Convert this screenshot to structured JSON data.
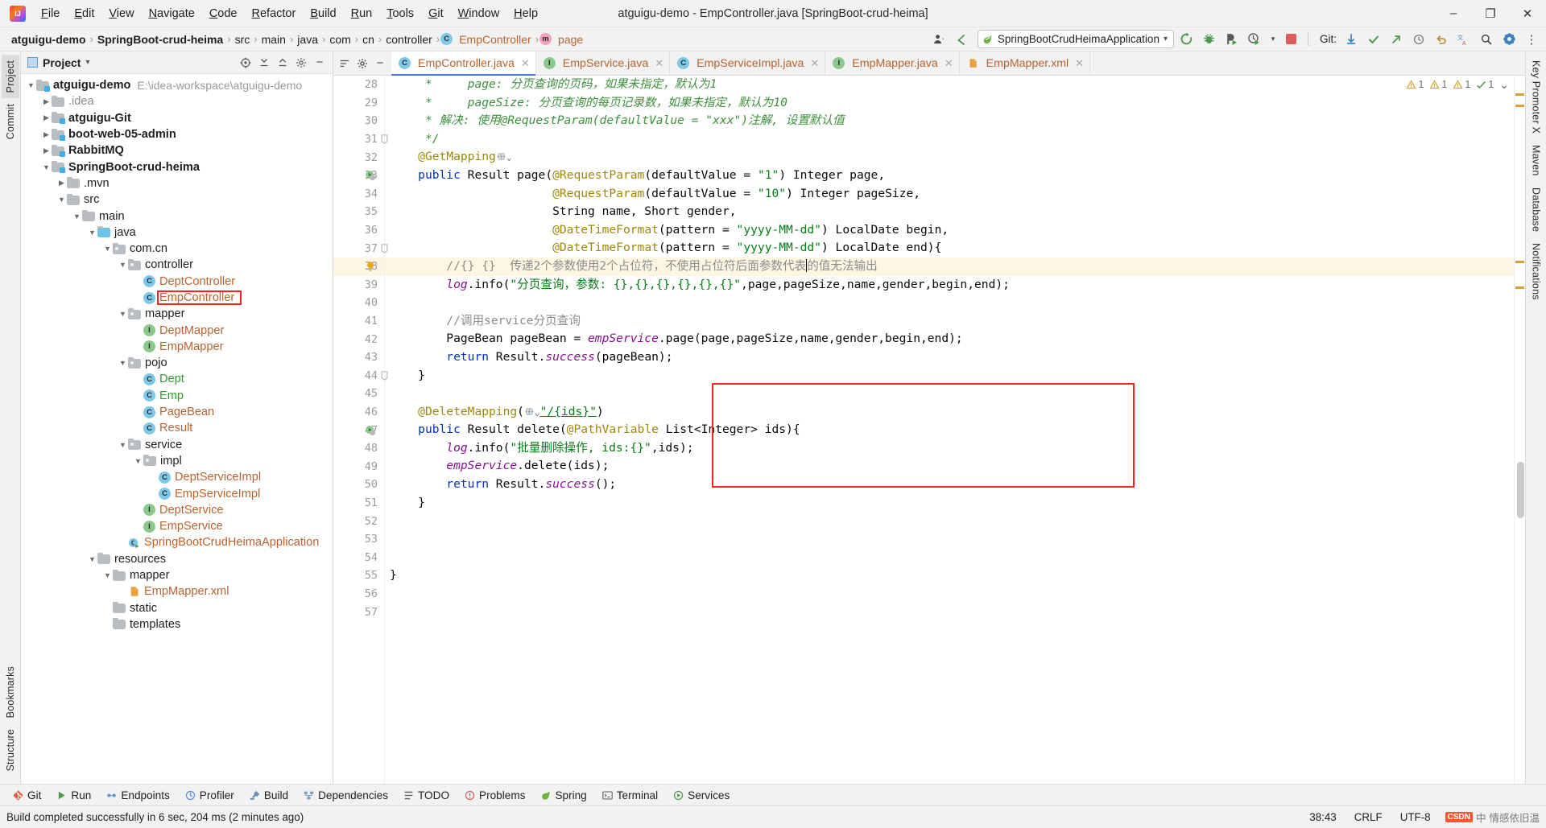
{
  "window": {
    "title": "atguigu-demo - EmpController.java [SpringBoot-crud-heima]",
    "minimize": "–",
    "maximize": "❐",
    "close": "✕"
  },
  "menubar": [
    {
      "label": "File"
    },
    {
      "label": "Edit"
    },
    {
      "label": "View"
    },
    {
      "label": "Navigate"
    },
    {
      "label": "Code"
    },
    {
      "label": "Refactor"
    },
    {
      "label": "Build"
    },
    {
      "label": "Run"
    },
    {
      "label": "Tools"
    },
    {
      "label": "Git"
    },
    {
      "label": "Window"
    },
    {
      "label": "Help"
    }
  ],
  "breadcrumb": [
    {
      "label": "atguigu-demo",
      "bold": true,
      "icon": ""
    },
    {
      "label": "SpringBoot-crud-heima",
      "bold": true,
      "icon": ""
    },
    {
      "label": "src",
      "bold": false,
      "icon": ""
    },
    {
      "label": "main",
      "bold": false,
      "icon": ""
    },
    {
      "label": "java",
      "bold": false,
      "icon": ""
    },
    {
      "label": "com",
      "bold": false,
      "icon": ""
    },
    {
      "label": "cn",
      "bold": false,
      "icon": ""
    },
    {
      "label": "controller",
      "bold": false,
      "icon": ""
    },
    {
      "label": "EmpController",
      "bold": false,
      "icon": "class",
      "orange": true
    },
    {
      "label": "page",
      "bold": false,
      "icon": "method",
      "orange": true
    }
  ],
  "toolbar": {
    "run_config": "SpringBootCrudHeimaApplication",
    "run_config_dropdown": "▾",
    "git_label": "Git:",
    "icons": {
      "user": "user-icon",
      "back_arrow": "back-arrow-icon",
      "rerun": "rerun-icon",
      "debug": "debug-icon",
      "run_with_coverage": "run-with-coverage-icon",
      "profiler": "profiler-icon",
      "stop": "stop-icon",
      "git_update": "git-update-icon",
      "git_commit": "git-commit-icon",
      "git_push": "git-push-icon",
      "git_history": "git-history-icon",
      "undo": "undo-icon",
      "translate": "translate-icon",
      "search": "search-icon",
      "settings_gear": "gear-icon",
      "more": "more-icon"
    }
  },
  "project_panel": {
    "title": "Project",
    "caret": "▾",
    "header_buttons": [
      "target-icon",
      "collapse-icon",
      "expand-icon",
      "gear-icon",
      "hide-icon"
    ],
    "tree": [
      {
        "depth": 0,
        "arrow": "v",
        "kind": "module",
        "label": "atguigu-demo",
        "bold": true,
        "path": "E:\\idea-workspace\\atguigu-demo"
      },
      {
        "depth": 1,
        "arrow": ">",
        "kind": "folder",
        "label": ".idea",
        "grey": true
      },
      {
        "depth": 1,
        "arrow": ">",
        "kind": "module",
        "label": "atguigu-Git",
        "bold": true
      },
      {
        "depth": 1,
        "arrow": ">",
        "kind": "module",
        "label": "boot-web-05-admin",
        "bold": true
      },
      {
        "depth": 1,
        "arrow": ">",
        "kind": "module",
        "label": "RabbitMQ",
        "bold": true
      },
      {
        "depth": 1,
        "arrow": "v",
        "kind": "module",
        "label": "SpringBoot-crud-heima",
        "bold": true
      },
      {
        "depth": 2,
        "arrow": ">",
        "kind": "folder",
        "label": ".mvn"
      },
      {
        "depth": 2,
        "arrow": "v",
        "kind": "folder",
        "label": "src"
      },
      {
        "depth": 3,
        "arrow": "v",
        "kind": "folder",
        "label": "main"
      },
      {
        "depth": 4,
        "arrow": "v",
        "kind": "source",
        "label": "java"
      },
      {
        "depth": 5,
        "arrow": "v",
        "kind": "package",
        "label": "com.cn"
      },
      {
        "depth": 6,
        "arrow": "v",
        "kind": "package",
        "label": "controller"
      },
      {
        "depth": 7,
        "arrow": "",
        "kind": "class",
        "label": "DeptController",
        "orange": true
      },
      {
        "depth": 7,
        "arrow": "",
        "kind": "class",
        "label": "EmpController",
        "orange": true,
        "highlight": true
      },
      {
        "depth": 6,
        "arrow": "v",
        "kind": "package",
        "label": "mapper"
      },
      {
        "depth": 7,
        "arrow": "",
        "kind": "iface",
        "label": "DeptMapper",
        "orange": true
      },
      {
        "depth": 7,
        "arrow": "",
        "kind": "iface",
        "label": "EmpMapper",
        "orange": true
      },
      {
        "depth": 6,
        "arrow": "v",
        "kind": "package",
        "label": "pojo"
      },
      {
        "depth": 7,
        "arrow": "",
        "kind": "class",
        "label": "Dept",
        "green": true
      },
      {
        "depth": 7,
        "arrow": "",
        "kind": "class",
        "label": "Emp",
        "green": true
      },
      {
        "depth": 7,
        "arrow": "",
        "kind": "class",
        "label": "PageBean",
        "orange": true
      },
      {
        "depth": 7,
        "arrow": "",
        "kind": "class",
        "label": "Result",
        "orange": true
      },
      {
        "depth": 6,
        "arrow": "v",
        "kind": "package",
        "label": "service"
      },
      {
        "depth": 7,
        "arrow": "v",
        "kind": "package",
        "label": "impl"
      },
      {
        "depth": 8,
        "arrow": "",
        "kind": "class",
        "label": "DeptServiceImpl",
        "orange": true
      },
      {
        "depth": 8,
        "arrow": "",
        "kind": "class",
        "label": "EmpServiceImpl",
        "orange": true
      },
      {
        "depth": 7,
        "arrow": "",
        "kind": "iface",
        "label": "DeptService",
        "orange": true
      },
      {
        "depth": 7,
        "arrow": "",
        "kind": "iface",
        "label": "EmpService",
        "orange": true
      },
      {
        "depth": 6,
        "arrow": "",
        "kind": "springboot",
        "label": "SpringBootCrudHeimaApplication",
        "orange": true
      },
      {
        "depth": 4,
        "arrow": "v",
        "kind": "resource",
        "label": "resources"
      },
      {
        "depth": 5,
        "arrow": "v",
        "kind": "folder",
        "label": "mapper"
      },
      {
        "depth": 6,
        "arrow": "",
        "kind": "xml",
        "label": "EmpMapper.xml",
        "orange": true
      },
      {
        "depth": 5,
        "arrow": "",
        "kind": "folder",
        "label": "static"
      },
      {
        "depth": 5,
        "arrow": "",
        "kind": "folder",
        "label": "templates"
      }
    ]
  },
  "left_rail": [
    {
      "label": "Project",
      "selected": true
    },
    {
      "label": "Commit",
      "selected": false
    },
    {
      "label": "Bookmarks",
      "selected": false
    },
    {
      "label": "Structure",
      "selected": false
    }
  ],
  "right_rail": [
    {
      "label": "Key Promoter X"
    },
    {
      "label": "Maven"
    },
    {
      "label": "Database"
    },
    {
      "label": "Notifications"
    }
  ],
  "editor_tabs": [
    {
      "label": "EmpController.java",
      "icon": "class",
      "active": true
    },
    {
      "label": "EmpService.java",
      "icon": "iface",
      "active": false
    },
    {
      "label": "EmpServiceImpl.java",
      "icon": "class",
      "active": false
    },
    {
      "label": "EmpMapper.java",
      "icon": "iface",
      "active": false
    },
    {
      "label": "EmpMapper.xml",
      "icon": "xml",
      "active": false
    }
  ],
  "inspection_status": {
    "warnings": "1",
    "weak_warnings": "1",
    "typos": "1",
    "checks": "1",
    "caret_down": "⌄"
  },
  "code": {
    "first_line": 28,
    "lines": [
      {
        "n": 28,
        "html": "     <span class='jdoc'>*     page: 分页查询的页码，如果未指定，默认为1</span>"
      },
      {
        "n": 29,
        "html": "     <span class='jdoc'>*     pageSize: 分页查询的每页记录数，如果未指定，默认为10</span>"
      },
      {
        "n": 30,
        "html": "     <span class='jdoc'>* 解决: 使用@RequestParam(defaultValue = \"xxx\")注解, 设置默认值</span>"
      },
      {
        "n": 31,
        "html": "     <span class='jdoc'>*/</span>",
        "fold": true
      },
      {
        "n": 32,
        "html": "    <span class='ann'>@GetMapping</span><span class='globe'></span>"
      },
      {
        "n": 33,
        "html": "    <span class='kw'>public</span> Result <span class='typ'>page</span>(<span class='ann'>@RequestParam</span>(defaultValue = <span class='str'>\"1\"</span>) Integer page,",
        "runmark": true
      },
      {
        "n": 34,
        "html": "                       <span class='ann'>@RequestParam</span>(defaultValue = <span class='str'>\"10\"</span>) Integer pageSize,"
      },
      {
        "n": 35,
        "html": "                       String name, Short gender,"
      },
      {
        "n": 36,
        "html": "                       <span class='ann'>@DateTimeFormat</span>(pattern = <span class='str'>\"yyyy-MM-dd\"</span>) LocalDate begin,"
      },
      {
        "n": 37,
        "html": "                       <span class='ann'>@DateTimeFormat</span>(pattern = <span class='str'>\"yyyy-MM-dd\"</span>) LocalDate end){",
        "fold": true
      },
      {
        "n": 38,
        "html": "        <span class='cmt'>//{} {}  传递2个参数使用2个占位符，不使用占位符后面参数代表<span class=\"caret\"></span>的值无法输出</span>",
        "highlight": true,
        "bulb": true
      },
      {
        "n": 39,
        "html": "        <span class='fld'>log</span>.info(<span class='str'>\"分页查询，参数: {},{},{},{},{},{}\"</span>,page,pageSize,name,gender,begin,end);"
      },
      {
        "n": 40,
        "html": ""
      },
      {
        "n": 41,
        "html": "        <span class='cmt'>//调用service分页查询</span>"
      },
      {
        "n": 42,
        "html": "        PageBean pageBean = <span class='fld'>empService</span>.page(page,pageSize,name,gender,begin,end);"
      },
      {
        "n": 43,
        "html": "        <span class='kw'>return</span> Result.<span class='fld'>success</span>(pageBean);"
      },
      {
        "n": 44,
        "html": "    }",
        "fold": true
      },
      {
        "n": 45,
        "html": ""
      },
      {
        "n": 46,
        "html": "    <span class='ann'>@DeleteMapping</span>(<span class='globe'></span><span class='str ulink'>\"/{ids}\"</span>)"
      },
      {
        "n": 47,
        "html": "    <span class='kw'>public</span> Result delete(<span class='ann'>@PathVariable</span> List&lt;Integer&gt; ids){",
        "runmark": true
      },
      {
        "n": 48,
        "html": "        <span class='fld'>log</span>.info(<span class='str'>\"批量删除操作, ids:{}\"</span>,ids);"
      },
      {
        "n": 49,
        "html": "        <span class='fld'>empService</span>.delete(ids);"
      },
      {
        "n": 50,
        "html": "        <span class='kw'>return</span> Result.<span class='fld'>success</span>();"
      },
      {
        "n": 51,
        "html": "    }"
      },
      {
        "n": 52,
        "html": ""
      },
      {
        "n": 53,
        "html": ""
      },
      {
        "n": 54,
        "html": ""
      },
      {
        "n": 55,
        "html": "}"
      },
      {
        "n": 56,
        "html": ""
      },
      {
        "n": 57,
        "html": ""
      }
    ]
  },
  "bottom_tools": [
    {
      "label": "Git",
      "icon": "git-icon"
    },
    {
      "label": "Run",
      "icon": "run-icon"
    },
    {
      "label": "Endpoints",
      "icon": "endpoints-icon"
    },
    {
      "label": "Profiler",
      "icon": "profiler-icon"
    },
    {
      "label": "Build",
      "icon": "build-icon"
    },
    {
      "label": "Dependencies",
      "icon": "dependencies-icon"
    },
    {
      "label": "TODO",
      "icon": "todo-icon"
    },
    {
      "label": "Problems",
      "icon": "problems-icon"
    },
    {
      "label": "Spring",
      "icon": "spring-icon"
    },
    {
      "label": "Terminal",
      "icon": "terminal-icon"
    },
    {
      "label": "Services",
      "icon": "services-icon"
    }
  ],
  "statusbar": {
    "message": "Build completed successfully in 6 sec, 204 ms (2 minutes ago)",
    "position": "38:43",
    "line_separator": "CRLF",
    "encoding": "UTF-8",
    "watermark": "中",
    "watermark_brand": "CSDN",
    "watermark_text": "情感依旧温"
  }
}
